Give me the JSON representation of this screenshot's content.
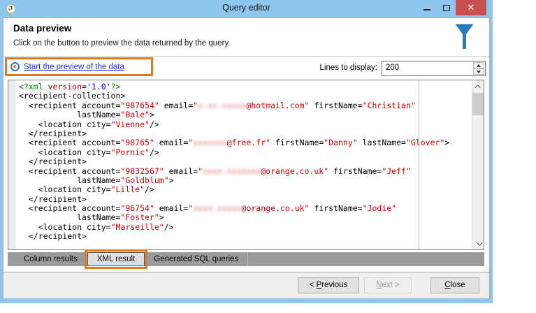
{
  "window": {
    "title": "Query editor",
    "controls": {
      "minimize": "minimize",
      "maximize": "maximize",
      "close_glyph": "✕"
    }
  },
  "header": {
    "title": "Data preview",
    "subtitle": "Click on the button to preview the data returned by the query."
  },
  "toolbar": {
    "preview_link": "Start the preview of the data",
    "lines_label": "Lines to display:",
    "lines_value": "200"
  },
  "xml": {
    "lines": [
      [
        {
          "c": "g",
          "t": "<?xml "
        },
        {
          "c": "m",
          "t": "version"
        },
        {
          "c": "d",
          "t": "="
        },
        {
          "c": "b",
          "t": "'1.0'"
        },
        {
          "c": "g",
          "t": "?>"
        }
      ],
      [
        {
          "c": "d",
          "t": "<recipient-collection>"
        }
      ],
      [
        {
          "c": "d",
          "t": "  <recipient account="
        },
        {
          "c": "v",
          "t": "\"987654\""
        },
        {
          "c": "d",
          "t": " email="
        },
        {
          "c": "v",
          "t": "\""
        },
        {
          "c": "r",
          "t": "x.xx.xxxxx"
        },
        {
          "c": "v",
          "t": "@hotmail.com\""
        },
        {
          "c": "d",
          "t": " firstName="
        },
        {
          "c": "v",
          "t": "\"Christian\""
        }
      ],
      [
        {
          "c": "d",
          "t": "            lastName="
        },
        {
          "c": "v",
          "t": "\"Bale\""
        },
        {
          "c": "d",
          "t": ">"
        }
      ],
      [
        {
          "c": "d",
          "t": "    <location city="
        },
        {
          "c": "v",
          "t": "\"Vienne\""
        },
        {
          "c": "d",
          "t": "/>"
        }
      ],
      [
        {
          "c": "d",
          "t": "  </recipient>"
        }
      ],
      [
        {
          "c": "d",
          "t": "  <recipient account="
        },
        {
          "c": "v",
          "t": "\"98765\""
        },
        {
          "c": "d",
          "t": " email="
        },
        {
          "c": "v",
          "t": "\""
        },
        {
          "c": "r",
          "t": "xxxxxxx"
        },
        {
          "c": "v",
          "t": "@free.fr\""
        },
        {
          "c": "d",
          "t": " firstName="
        },
        {
          "c": "v",
          "t": "\"Danny\""
        },
        {
          "c": "d",
          "t": " lastName="
        },
        {
          "c": "v",
          "t": "\"Glover\""
        },
        {
          "c": "d",
          "t": ">"
        }
      ],
      [
        {
          "c": "d",
          "t": "    <location city="
        },
        {
          "c": "v",
          "t": "\"Pornic\""
        },
        {
          "c": "d",
          "t": "/>"
        }
      ],
      [
        {
          "c": "d",
          "t": "  </recipient>"
        }
      ],
      [
        {
          "c": "d",
          "t": "  <recipient account="
        },
        {
          "c": "v",
          "t": "\"9832567\""
        },
        {
          "c": "d",
          "t": " email="
        },
        {
          "c": "v",
          "t": "\""
        },
        {
          "c": "r",
          "t": "xxxx.xxxxxxx"
        },
        {
          "c": "v",
          "t": "@orange.co.uk\""
        },
        {
          "c": "d",
          "t": " firstName="
        },
        {
          "c": "v",
          "t": "\"Jeff\""
        }
      ],
      [
        {
          "c": "d",
          "t": "            lastName="
        },
        {
          "c": "v",
          "t": "\"Goldblum\""
        },
        {
          "c": "d",
          "t": ">"
        }
      ],
      [
        {
          "c": "d",
          "t": "    <location city="
        },
        {
          "c": "v",
          "t": "\"Lille\""
        },
        {
          "c": "d",
          "t": "/>"
        }
      ],
      [
        {
          "c": "d",
          "t": "  </recipient>"
        }
      ],
      [
        {
          "c": "d",
          "t": "  <recipient account="
        },
        {
          "c": "v",
          "t": "\"96754\""
        },
        {
          "c": "d",
          "t": " email="
        },
        {
          "c": "v",
          "t": "\""
        },
        {
          "c": "r",
          "t": "xxxx.xxxxx"
        },
        {
          "c": "v",
          "t": "@orange.co.uk\""
        },
        {
          "c": "d",
          "t": " firstName="
        },
        {
          "c": "v",
          "t": "\"Jodie\""
        }
      ],
      [
        {
          "c": "d",
          "t": "            lastName="
        },
        {
          "c": "v",
          "t": "\"Foster\""
        },
        {
          "c": "d",
          "t": ">"
        }
      ],
      [
        {
          "c": "d",
          "t": "    <location city="
        },
        {
          "c": "v",
          "t": "\"Marseille\""
        },
        {
          "c": "d",
          "t": "/>"
        }
      ],
      [
        {
          "c": "d",
          "t": "  </recipient>"
        }
      ]
    ]
  },
  "tabs": [
    {
      "label": "Column results",
      "active": false
    },
    {
      "label": "XML result",
      "active": true
    },
    {
      "label": "Generated SQL queries",
      "active": false
    }
  ],
  "footer": {
    "previous": {
      "label": "< Previous",
      "mnemonic": 2
    },
    "next": {
      "label": "Next >",
      "mnemonic": 0
    },
    "close": {
      "label": "Close",
      "mnemonic": 0
    }
  },
  "colors": {
    "frame_blue": "#8EC6F0",
    "close_red": "#C85050",
    "annotation_orange": "#E2791F",
    "funnel_blue": "#2A7ABF",
    "link_blue": "#2133CC",
    "xml_value_red": "#CC0000",
    "xml_pi_green": "#008000",
    "xml_version_maroon": "#990000",
    "xml_literal_blue": "#0000CC",
    "tabbar_gray": "#9B9B9B"
  }
}
